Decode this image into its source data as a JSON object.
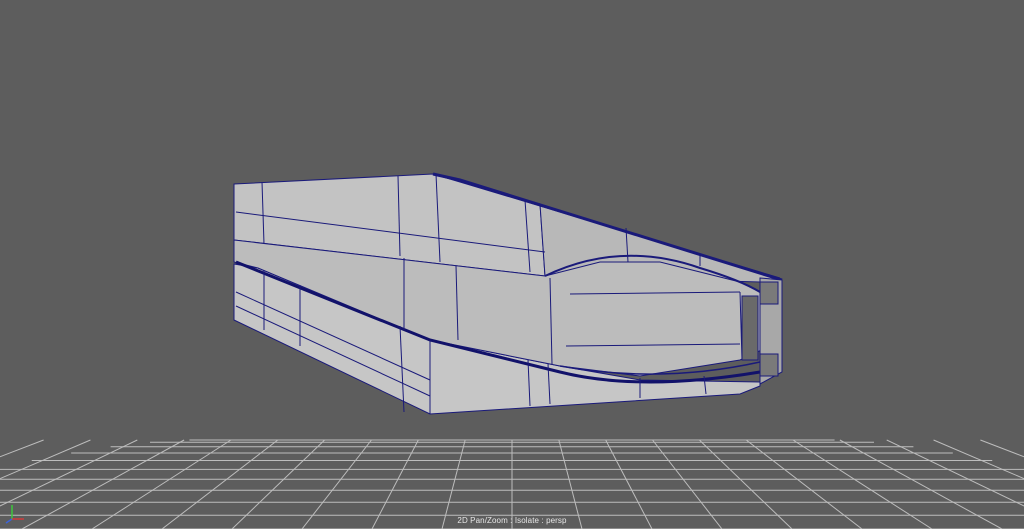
{
  "viewport": {
    "camera": "persp",
    "hud_text": "2D Pan/Zoom : Isolate : persp",
    "background_color": "#5d5d5d",
    "grid_color": "#bdbdbd",
    "mesh_fill_color": "#bcbcbc",
    "wire_color": "#1a1a7a"
  },
  "axis_gizmo": {
    "icon": "axis-gizmo-icon",
    "colors": {
      "x": "#d23c3c",
      "y": "#3cc83c",
      "z": "#3c64dc"
    }
  }
}
